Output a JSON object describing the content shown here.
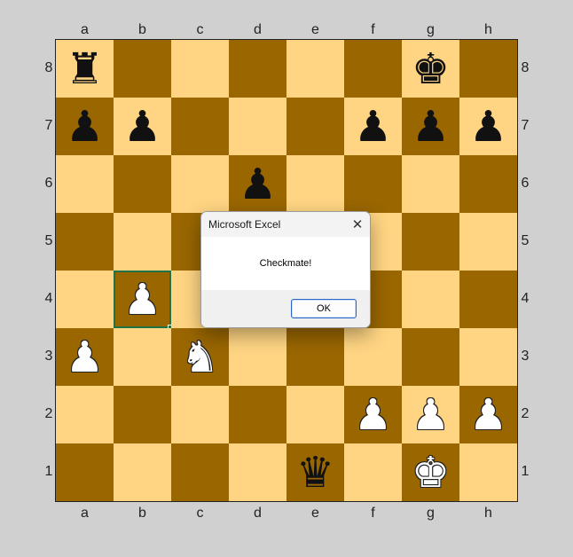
{
  "board": {
    "files": [
      "a",
      "b",
      "c",
      "d",
      "e",
      "f",
      "g",
      "h"
    ],
    "ranks": [
      "8",
      "7",
      "6",
      "5",
      "4",
      "3",
      "2",
      "1"
    ],
    "selected_square": "b4",
    "colors": {
      "light": "#ffd583",
      "dark": "#996600",
      "selection": "#217346"
    },
    "pieces": {
      "a8": {
        "symbol": "♜",
        "color": "black",
        "name": "black-rook"
      },
      "g8": {
        "symbol": "♚",
        "color": "black",
        "name": "black-king"
      },
      "a7": {
        "symbol": "♟",
        "color": "black",
        "name": "black-pawn"
      },
      "b7": {
        "symbol": "♟",
        "color": "black",
        "name": "black-pawn"
      },
      "f7": {
        "symbol": "♟",
        "color": "black",
        "name": "black-pawn"
      },
      "g7": {
        "symbol": "♟",
        "color": "black",
        "name": "black-pawn"
      },
      "h7": {
        "symbol": "♟",
        "color": "black",
        "name": "black-pawn"
      },
      "d6": {
        "symbol": "♟",
        "color": "black",
        "name": "black-pawn"
      },
      "b4": {
        "symbol": "♟",
        "color": "white",
        "name": "white-pawn"
      },
      "a3": {
        "symbol": "♟",
        "color": "white",
        "name": "white-pawn"
      },
      "c3": {
        "symbol": "♞",
        "color": "white",
        "name": "white-knight"
      },
      "f2": {
        "symbol": "♟",
        "color": "white",
        "name": "white-pawn"
      },
      "g2": {
        "symbol": "♟",
        "color": "white",
        "name": "white-pawn"
      },
      "h2": {
        "symbol": "♟",
        "color": "white",
        "name": "white-pawn"
      },
      "e1": {
        "symbol": "♛",
        "color": "black",
        "name": "black-queen"
      },
      "g1": {
        "symbol": "♚",
        "color": "white",
        "name": "white-king"
      }
    }
  },
  "dialog": {
    "title": "Microsoft Excel",
    "message": "Checkmate!",
    "ok_label": "OK",
    "close_glyph": "✕"
  }
}
